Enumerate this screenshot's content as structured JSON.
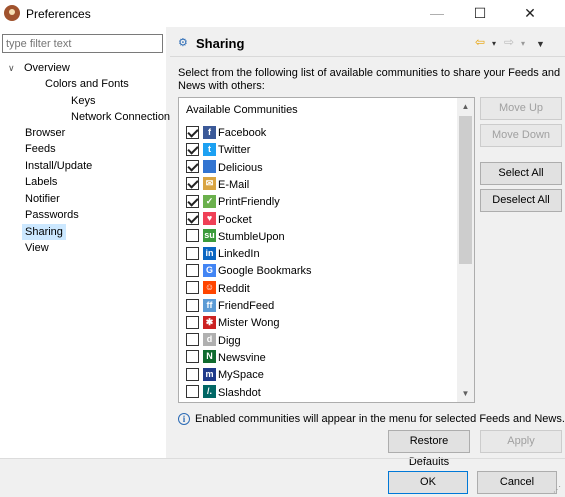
{
  "window": {
    "title": "Preferences",
    "minimize": "—",
    "maximize": "☐",
    "close": "✕"
  },
  "tree": {
    "filter_placeholder": "type filter text",
    "items": [
      {
        "label": "Overview",
        "arrow": "∨"
      },
      {
        "label": "Colors and Fonts"
      },
      {
        "label": "Keys"
      },
      {
        "label": "Network Connections"
      },
      {
        "label": "Browser"
      },
      {
        "label": "Feeds"
      },
      {
        "label": "Install/Update"
      },
      {
        "label": "Labels"
      },
      {
        "label": "Notifier"
      },
      {
        "label": "Passwords"
      },
      {
        "label": "Sharing",
        "selected": true
      },
      {
        "label": "View"
      }
    ]
  },
  "header": {
    "title": "Sharing",
    "back_icon": "⇦",
    "forward_icon": "⇨",
    "dropdown_icon": "▾",
    "menu_icon": "▼"
  },
  "description": "Select from the following list of available communities to share your Feeds and News with others:",
  "list": {
    "header": "Available Communities",
    "items": [
      {
        "label": "Facebook",
        "checked": true,
        "icon": "facebook-icon",
        "color": "#3b5998",
        "glyph": "f"
      },
      {
        "label": "Twitter",
        "checked": true,
        "icon": "twitter-icon",
        "color": "#1da1f2",
        "glyph": "t"
      },
      {
        "label": "Delicious",
        "checked": true,
        "icon": "delicious-icon",
        "color": "#3274d1",
        "glyph": ""
      },
      {
        "label": "E-Mail",
        "checked": true,
        "icon": "email-icon",
        "color": "#d9a441",
        "glyph": "✉"
      },
      {
        "label": "PrintFriendly",
        "checked": true,
        "icon": "printfriendly-icon",
        "color": "#6ab04c",
        "glyph": "✓"
      },
      {
        "label": "Pocket",
        "checked": true,
        "icon": "pocket-icon",
        "color": "#ef4056",
        "glyph": "♥"
      },
      {
        "label": "StumbleUpon",
        "checked": false,
        "icon": "stumbleupon-icon",
        "color": "#3b9b3b",
        "glyph": "su"
      },
      {
        "label": "LinkedIn",
        "checked": false,
        "icon": "linkedin-icon",
        "color": "#0a66c2",
        "glyph": "in"
      },
      {
        "label": "Google Bookmarks",
        "checked": false,
        "icon": "google-bookmarks-icon",
        "color": "#4285f4",
        "glyph": "G"
      },
      {
        "label": "Reddit",
        "checked": false,
        "icon": "reddit-icon",
        "color": "#ff4500",
        "glyph": "☺"
      },
      {
        "label": "FriendFeed",
        "checked": false,
        "icon": "friendfeed-icon",
        "color": "#5b9bd5",
        "glyph": "ff"
      },
      {
        "label": "Mister Wong",
        "checked": false,
        "icon": "mister-wong-icon",
        "color": "#cc2222",
        "glyph": "✱"
      },
      {
        "label": "Digg",
        "checked": false,
        "icon": "digg-icon",
        "color": "#b0b0b0",
        "glyph": "d"
      },
      {
        "label": "Newsvine",
        "checked": false,
        "icon": "newsvine-icon",
        "color": "#0f6b2f",
        "glyph": "N"
      },
      {
        "label": "MySpace",
        "checked": false,
        "icon": "myspace-icon",
        "color": "#1e3a8a",
        "glyph": "m"
      },
      {
        "label": "Slashdot",
        "checked": false,
        "icon": "slashdot-icon",
        "color": "#016765",
        "glyph": "/."
      }
    ]
  },
  "buttons": {
    "move_up": "Move Up",
    "move_down": "Move Down",
    "select_all": "Select All",
    "deselect_all": "Deselect All",
    "restore_defaults": "Restore Defaults",
    "apply": "Apply",
    "ok": "OK",
    "cancel": "Cancel"
  },
  "info_text": "Enabled communities will appear in the menu for selected Feeds and News."
}
